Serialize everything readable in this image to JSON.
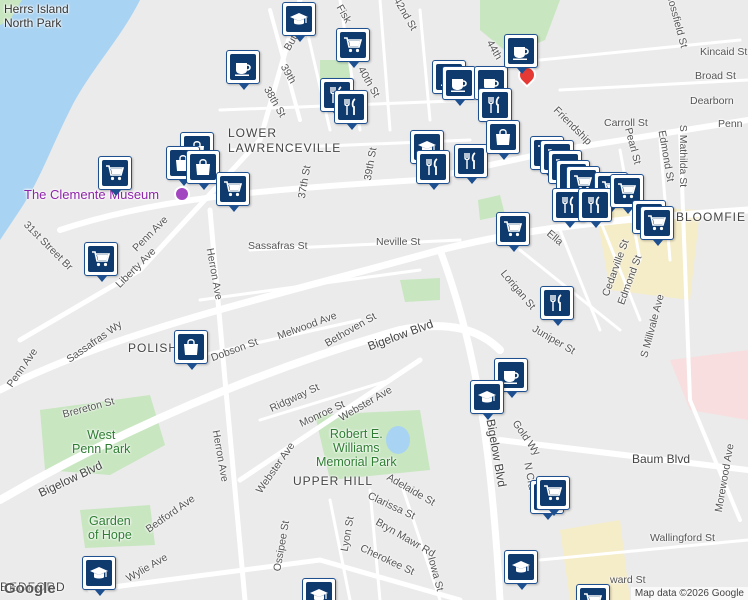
{
  "map": {
    "colors": {
      "land": "#ebebeb",
      "water": "#a9d3f2",
      "park": "#c8e6c0",
      "road": "#ffffff",
      "commercial": "#f5ecc8",
      "medical": "#f8dede",
      "marker_icon": "#0e3a6e"
    },
    "labels": {
      "herrs_island": "Herrs Island\nNorth Park",
      "lower_lawrenceville": "LOWER\nLAWRENCEVILLE",
      "polish_hill": "POLISH",
      "bloomfield": "BLOOMFIE",
      "upper_hill": "UPPER HILL",
      "west_penn_park": "West\nPenn Park",
      "robert_williams_park": "Robert E.\nWilliams\nMemorial Park",
      "garden_of_hope": "Garden\nof Hope",
      "museum": "The Clemente Museum",
      "bedford": "BEDFORD",
      "streets": {
        "butler": "Butler",
        "fisk": "Fisk",
        "s42nd": "42nd St",
        "s44th": "44th",
        "mossfield": "Mossfield St",
        "kincaid": "Kincaid St",
        "broad": "Broad St",
        "dearborn": "Dearborn",
        "penn_ne": "Penn",
        "carroll": "Carroll St",
        "friendship": "Friendship",
        "pearl": "Pearl St",
        "edmond1": "Edmond St",
        "s_mathilda": "S Mathilda St",
        "s39th_a": "39th",
        "s40th": "40th St",
        "s38th": "38th St",
        "s37th": "37th St",
        "s39th_b": "39th St",
        "s31st": "31st Street Br",
        "penn_ave_mid": "Penn Ave",
        "liberty": "Liberty Ave",
        "sassafras": "Sassafras St",
        "neville": "Neville St",
        "herron_top": "Herron Ave",
        "sassafras_wy": "Sassafras Wy",
        "penn_ave_left": "Penn Ave",
        "dobson": "Dobson St",
        "melwood": "Melwood Ave",
        "bethoven": "Bethoven St",
        "bigelow_top": "Bigelow Blvd",
        "lorigan": "Lorigan St",
        "juniper": "Juniper St",
        "cedarville": "Cedarville St",
        "edmond2": "Edmond St",
        "s_millvale": "S Millvale Ave",
        "ella": "Ella",
        "dalmine": "Ella",
        "brereton": "Brereton St",
        "ridgway": "Ridgway St",
        "monroe": "Monroe St",
        "webster_top": "Webster Ave",
        "herron_bottom": "Herron Ave",
        "webster_mid": "Webster Ave",
        "bigelow_left": "Bigelow Blvd",
        "bigelow_right": "Bigelow Blvd",
        "gold": "Gold Wy",
        "baum": "Baum Blvd",
        "morewood": "Morewood Ave",
        "bedford_ave": "Bedford Ave",
        "adelaide": "Adelaide St",
        "clarissa": "Clarissa St",
        "bryn_mawr": "Bryn Mawr Rd",
        "lyon": "Lyon St",
        "cherokee": "Cherokee St",
        "iowa": "Iowa St",
        "ossipee": "Ossipee St",
        "wylie": "Wylie Ave",
        "wallingford": "Wallingford St",
        "ward": "ward St",
        "n_craig": "N Cra",
        "webster_bl": "Webst"
      }
    },
    "attribution": "Map data ©2026 Google",
    "logo": "Google"
  }
}
